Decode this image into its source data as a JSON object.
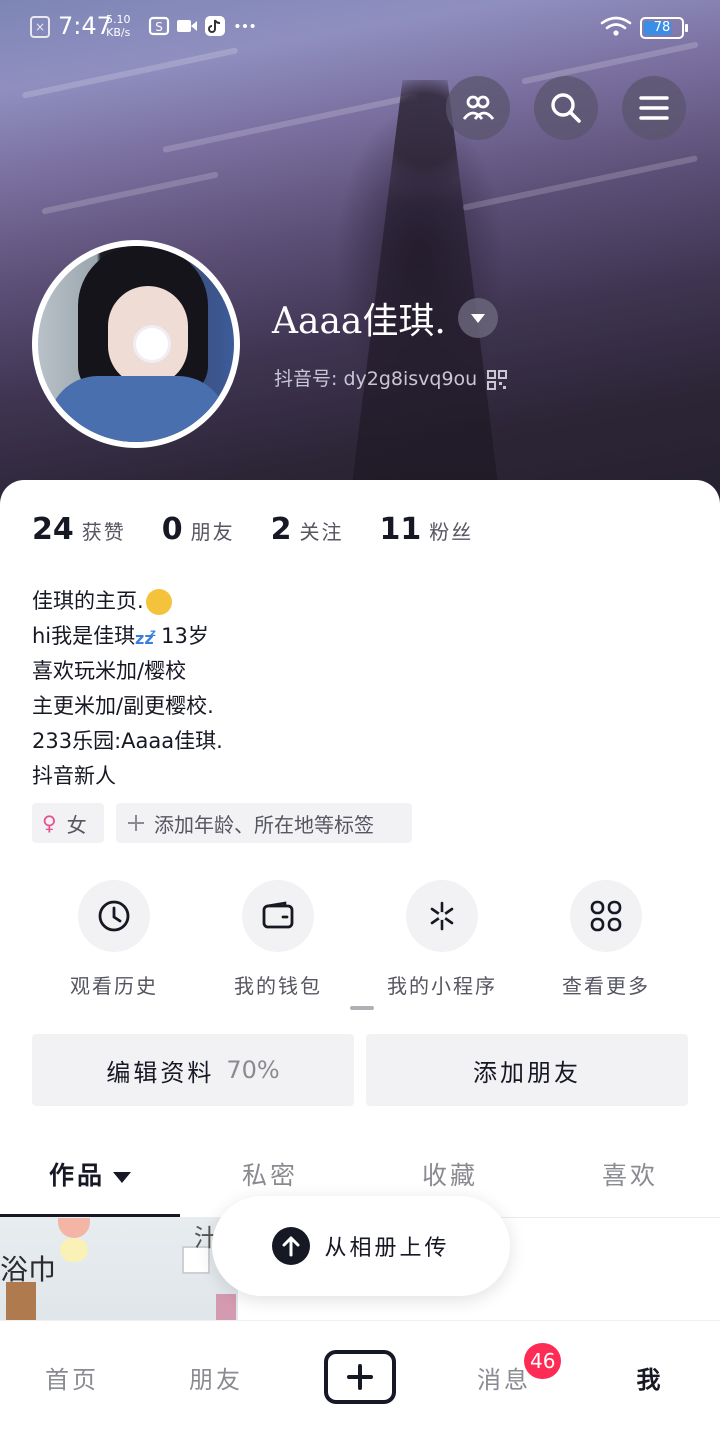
{
  "status_bar": {
    "time": "7:47",
    "net_speed_value": "5.10",
    "net_speed_unit": "KB/s",
    "battery_level": "78",
    "battery_fraction": 0.78
  },
  "profile": {
    "name": "Aaaa佳琪.",
    "douyin_id": "抖音号: dy2g8isvq9ou"
  },
  "stats": [
    {
      "num": "24",
      "label": "获赞"
    },
    {
      "num": "0",
      "label": "朋友"
    },
    {
      "num": "2",
      "label": "关注"
    },
    {
      "num": "11",
      "label": "粉丝"
    }
  ],
  "bio": {
    "line1": "佳琪的主页.",
    "line2": "hi我是佳琪",
    "line2_suffix": "13岁",
    "line3": "喜欢玩米加/樱校",
    "line4": "主更米加/副更樱校.",
    "line5": "233乐园:Aaaa佳琪.",
    "line6": "抖音新人"
  },
  "tags": {
    "gender_symbol": "♀",
    "gender": "女",
    "add_tags": "添加年龄、所在地等标签"
  },
  "entries": [
    {
      "label": "观看历史",
      "icon": "clock-icon"
    },
    {
      "label": "我的钱包",
      "icon": "wallet-icon"
    },
    {
      "label": "我的小程序",
      "icon": "mini-program-icon"
    },
    {
      "label": "查看更多",
      "icon": "grid-icon"
    }
  ],
  "buttons": {
    "edit_profile": "编辑资料",
    "edit_progress": "70%",
    "add_friend": "添加朋友"
  },
  "content_tabs": [
    "作品",
    "私密",
    "收藏",
    "喜欢"
  ],
  "thumbnail_text": {
    "main": "浴巾",
    "corner": "汁"
  },
  "upload": {
    "label": "从相册上传"
  },
  "bottom_nav": {
    "home": "首页",
    "friends": "朋友",
    "messages": "消息",
    "messages_badge": "46",
    "me": "我"
  },
  "colors": {
    "accent_badge": "#fe2c55",
    "text_primary": "#161823",
    "text_secondary": "#8a8b91",
    "gender_pink": "#e8508f"
  }
}
